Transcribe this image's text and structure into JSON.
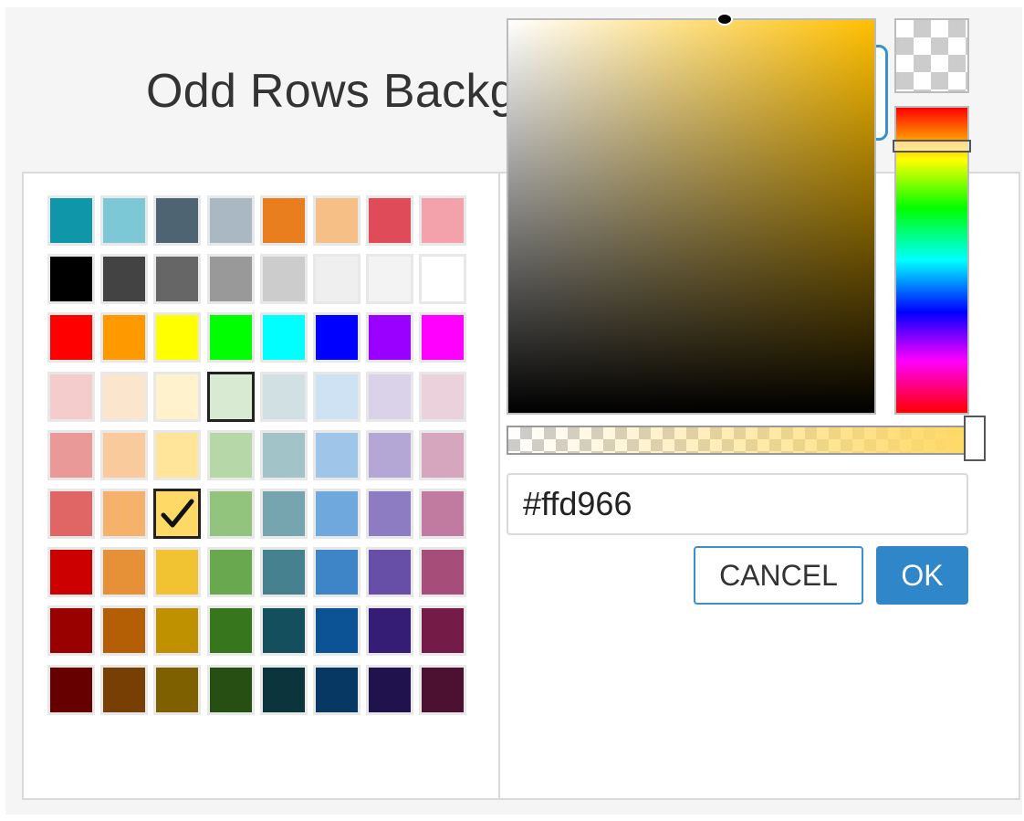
{
  "property": {
    "label": "Odd Rows Background",
    "current_color": "#ffd966"
  },
  "palette": {
    "rows": [
      [
        "#0f96a8",
        "#7dc8d6",
        "#4e6472",
        "#a9b8c2",
        "#e87e1e",
        "#f5bf86",
        "#e04b5a",
        "#f3a2ac"
      ],
      [
        "#000000",
        "#434343",
        "#666666",
        "#999999",
        "#cccccc",
        "#efefef",
        "#f3f3f3",
        "#ffffff"
      ],
      [
        "#ff0000",
        "#ff9900",
        "#ffff00",
        "#00ff00",
        "#00ffff",
        "#0000ff",
        "#9900ff",
        "#ff00ff"
      ],
      [
        "#f4cccc",
        "#fce5cd",
        "#fff2cc",
        "#d9ead3",
        "#d0e0e3",
        "#cfe2f3",
        "#d9d2e9",
        "#ead1dc"
      ],
      [
        "#ea9999",
        "#f9cb9c",
        "#ffe599",
        "#b6d7a8",
        "#a2c4c9",
        "#9fc5e8",
        "#b4a7d6",
        "#d5a6bd"
      ],
      [
        "#e06666",
        "#f6b26b",
        "#ffd966",
        "#93c47d",
        "#76a5af",
        "#6fa8dc",
        "#8e7cc3",
        "#c27ba0"
      ],
      [
        "#cc0000",
        "#e69138",
        "#f1c232",
        "#6aa84f",
        "#45818e",
        "#3d85c6",
        "#674ea7",
        "#a64d79"
      ],
      [
        "#990000",
        "#b45f06",
        "#bf9000",
        "#38761d",
        "#134f5c",
        "#0b5394",
        "#351c75",
        "#741b47"
      ],
      [
        "#660000",
        "#783f04",
        "#7f6000",
        "#274e13",
        "#0c343d",
        "#073763",
        "#20124d",
        "#4c1130"
      ]
    ],
    "selected": {
      "row": 5,
      "col": 2
    },
    "hovered": {
      "row": 3,
      "col": 3
    }
  },
  "picker": {
    "hue_color": "#ffbf00",
    "hex_value": "#ffd966"
  },
  "buttons": {
    "cancel_label": "CANCEL",
    "ok_label": "OK"
  },
  "icons": {
    "dropdown": "caret-down-icon",
    "selected": "checkmark-icon",
    "transparent": "checkerboard-icon"
  }
}
